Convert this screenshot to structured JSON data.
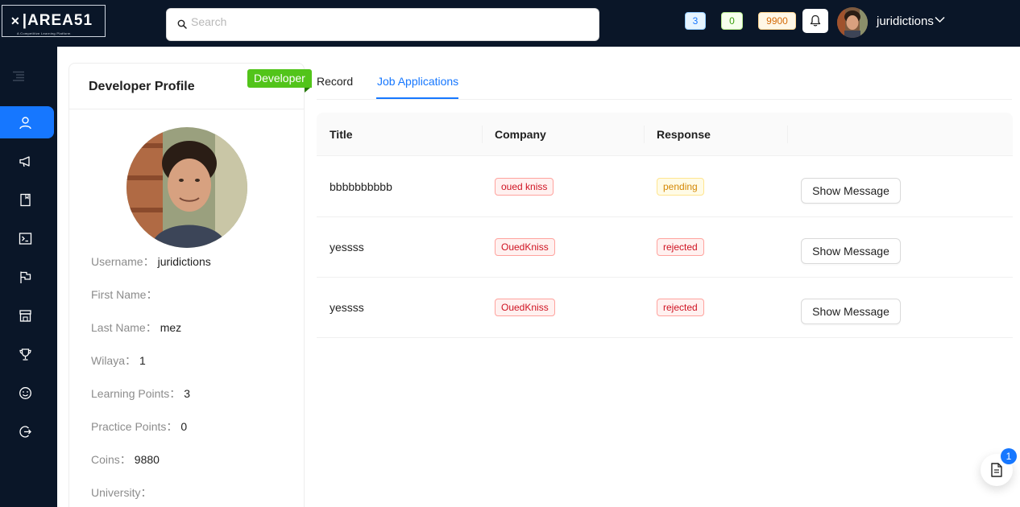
{
  "header": {
    "logo_text": "AREA51",
    "logo_tagline": "A Competitive Learning Platform",
    "search_placeholder": "Search",
    "stat_blue": "3",
    "stat_green": "0",
    "stat_orange": "9900",
    "username": "juridictions"
  },
  "sidebar": {
    "items": [
      {
        "icon": "user-icon"
      },
      {
        "icon": "megaphone-icon"
      },
      {
        "icon": "book-icon"
      },
      {
        "icon": "terminal-icon"
      },
      {
        "icon": "flag-icon"
      },
      {
        "icon": "shop-icon"
      },
      {
        "icon": "trophy-icon"
      },
      {
        "icon": "smile-icon"
      },
      {
        "icon": "logout-icon"
      }
    ]
  },
  "profile": {
    "title": "Developer Profile",
    "role_ribbon": "Developer",
    "fields": [
      {
        "label": "Username：",
        "value": "juridictions"
      },
      {
        "label": "First Name：",
        "value": ""
      },
      {
        "label": "Last Name：",
        "value": "mez"
      },
      {
        "label": "Wilaya：",
        "value": "1"
      },
      {
        "label": "Learning Points：",
        "value": "3"
      },
      {
        "label": "Practice Points：",
        "value": "0"
      },
      {
        "label": "Coins：",
        "value": "9880"
      },
      {
        "label": "University：",
        "value": ""
      }
    ]
  },
  "tabs": [
    {
      "label": "Record",
      "active": false
    },
    {
      "label": "Job Applications",
      "active": true
    }
  ],
  "table": {
    "columns": [
      "Title",
      "Company",
      "Response",
      ""
    ],
    "rows": [
      {
        "title": "bbbbbbbbbb",
        "company": "oued kniss",
        "response": "pending",
        "action": "Show Message"
      },
      {
        "title": "yessss",
        "company": "OuedKniss",
        "response": "rejected",
        "action": "Show Message"
      },
      {
        "title": "yessss",
        "company": "OuedKniss",
        "response": "rejected",
        "action": "Show Message"
      }
    ]
  },
  "float_button": {
    "icon": "file-text-icon",
    "badge": "1"
  },
  "colors": {
    "nav_bg": "#0a1628",
    "accent": "#1677ff",
    "ribbon": "#52c41a",
    "tag_red": "#cf1322",
    "tag_gold": "#d48806"
  }
}
